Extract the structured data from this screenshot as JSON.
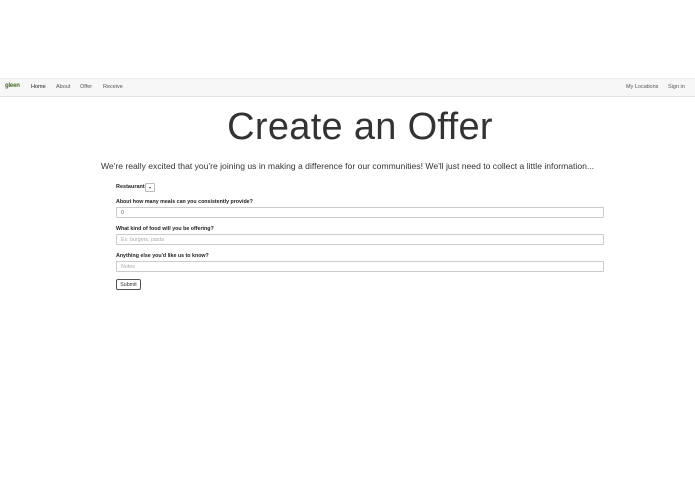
{
  "nav": {
    "brand": "gleen",
    "items": [
      "Home",
      "About",
      "Offer",
      "Receive"
    ],
    "right": [
      "My Locations",
      "Sign in"
    ]
  },
  "page": {
    "title": "Create an Offer",
    "intro": "We're really excited that you're joining us in making a difference for our communities! We'll just need to collect a little information..."
  },
  "form": {
    "type_label": "Restaurant",
    "select_arrow": "▾",
    "meals_label": "About how many meals can you consistently provide?",
    "meals_value": "0",
    "food_label": "What kind of food will you be offering?",
    "food_placeholder": "Ex: burgers, pasta",
    "notes_label": "Anything else you'd like us to know?",
    "notes_placeholder": "Notes",
    "submit_label": "Submit"
  }
}
